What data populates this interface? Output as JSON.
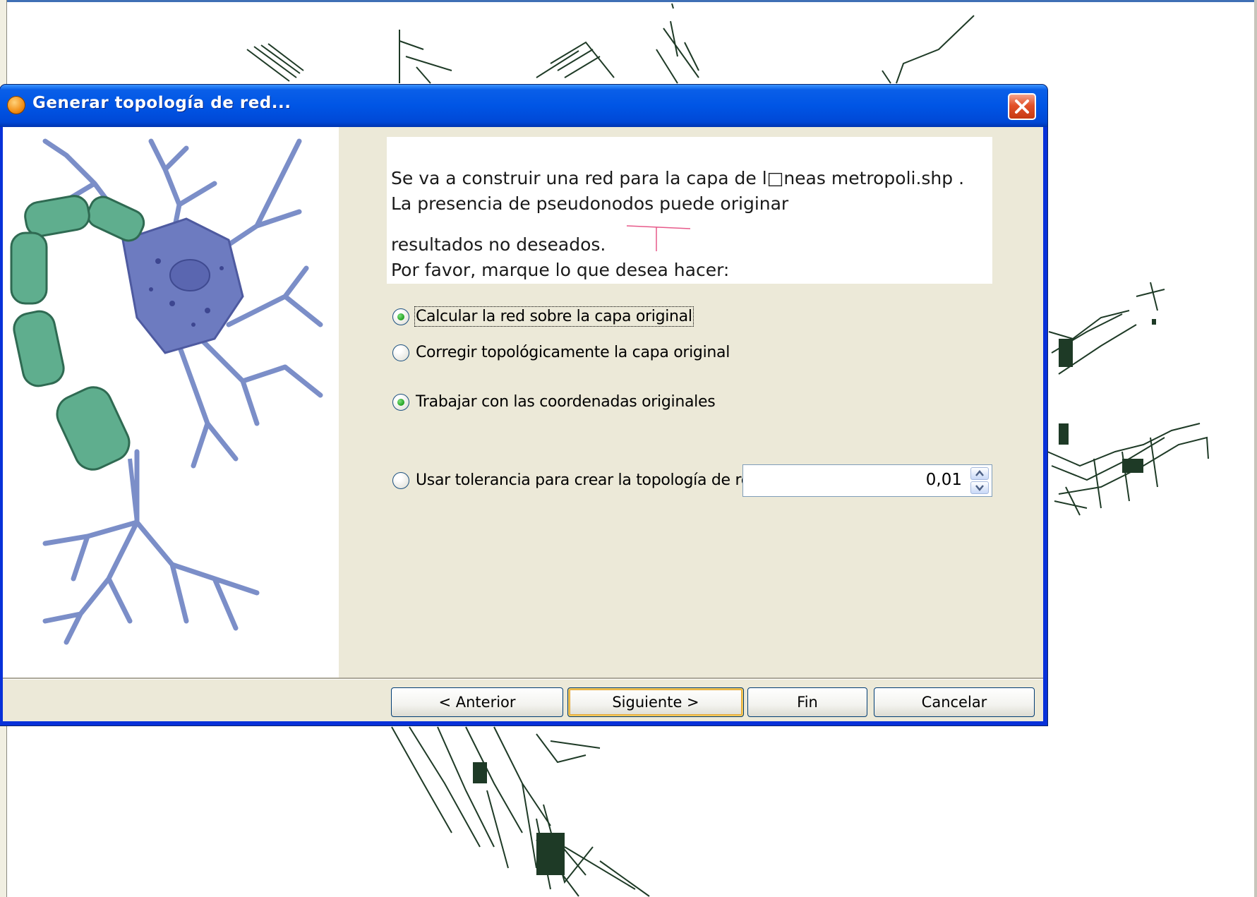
{
  "dialog": {
    "title": "Generar topología de red...",
    "message_lines": [
      "Se va a construir una red para la capa de l□neas metropoli.shp .",
      "La presencia de pseudonodos puede originar",
      "resultados no deseados.",
      "Por favor, marque lo que desea hacer:"
    ],
    "options": {
      "calculate_label": "Calcular la red sobre la capa original",
      "correct_label": "Corregir topológicamente la capa original",
      "selected_mode": "Calcular la red sobre la capa original",
      "original_coords_label": "Trabajar con las coordenadas originales",
      "tolerance_label": "Usar tolerancia para crear la topología de red",
      "selected_coords": "Trabajar con las coordenadas originales"
    },
    "tolerance": {
      "value": "0,01"
    },
    "buttons": {
      "back": "< Anterior",
      "next": "Siguiente >",
      "finish": "Fin",
      "cancel": "Cancelar"
    }
  },
  "colors": {
    "titlebar": "#0055e5",
    "client_bg": "#ece9d8",
    "map_lines": "#1e3a26",
    "neuron_axon": "#5fae8e",
    "neuron_body": "#6d7bc0"
  },
  "icons": {
    "title": "gvsig-app-icon",
    "close": "close-icon",
    "spinner_up": "chevron-up-icon",
    "spinner_down": "chevron-down-icon"
  }
}
